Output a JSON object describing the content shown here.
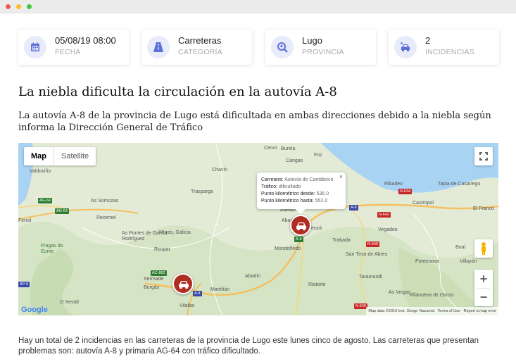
{
  "cards": [
    {
      "value": "05/08/19 08:00",
      "label": "FECHA",
      "icon": "calendar-icon"
    },
    {
      "value": "Carreteras",
      "label": "CATEGORÍA",
      "icon": "road-icon"
    },
    {
      "value": "Lugo",
      "label": "PROVINCIA",
      "icon": "search-map-icon"
    },
    {
      "value": "2",
      "label": "INCIDENCIAS",
      "icon": "car-crash-icon"
    }
  ],
  "article": {
    "title": "La niebla dificulta la circulación en la autovía A-8",
    "subtitle": "La autovía A-8 de la provincia de Lugo está dificultada en ambas direcciones debido a la niebla según informa la Dirección General de Tráfico",
    "body": "Hay un total de 2 incidencias en las carreteras de la provincia de Lugo este lunes cinco de agosto. Las carreteras que presentan problemas son: autovía A-8 y primaria AG-64 con tráfico dificultado."
  },
  "map": {
    "type_map": "Map",
    "type_satellite": "Satellite",
    "zoom_in": "+",
    "zoom_out": "−",
    "logo": "Google",
    "attribution": [
      "Map data ©2019 Inst. Geogr. Nacional",
      "Terms of Use",
      "Report a map error"
    ],
    "infowindow": {
      "road_k": "Carretera:",
      "road_v": "Autovía do Cantábrico",
      "traffic_k": "Tráfico:",
      "traffic_v": "dificultado",
      "from_k": "Punto kilométrico desde:",
      "from_v": "536.0",
      "to_k": "Punto kilométrico hasta:",
      "to_v": "552.0",
      "close": "×"
    },
    "places": [
      "Cervo",
      "Burela",
      "Foz",
      "Cangas",
      "Ribadeo",
      "Tapia de Casariego",
      "Castropol",
      "El Franco",
      "Vegadeo",
      "Valdoviño",
      "As Somozas",
      "Recemel",
      "Chavín",
      "Trasparga",
      "Adelán",
      "Abadín",
      "Mondoñedo",
      "Trabada",
      "San Tirso de Abres",
      "Taramundi",
      "Boal",
      "Villayón",
      "As Pontes de García Rodríguez",
      "Muras, Galicia",
      "Fragas do Eume",
      "Roupar",
      "Xermade",
      "Burgás",
      "Abadín",
      "Martiñán",
      "Riotorto",
      "As Veigas",
      "Villanueva de Oscos",
      "Vilalba",
      "O Xestal",
      "Lourenzá",
      "Ferrol",
      "Pontenova"
    ],
    "road_labels": [
      "AG-64",
      "AG-64",
      "A-8",
      "A-8",
      "A-8",
      "N-642",
      "N-634",
      "N-640",
      "N-640",
      "AP-9",
      "AC-862"
    ]
  }
}
